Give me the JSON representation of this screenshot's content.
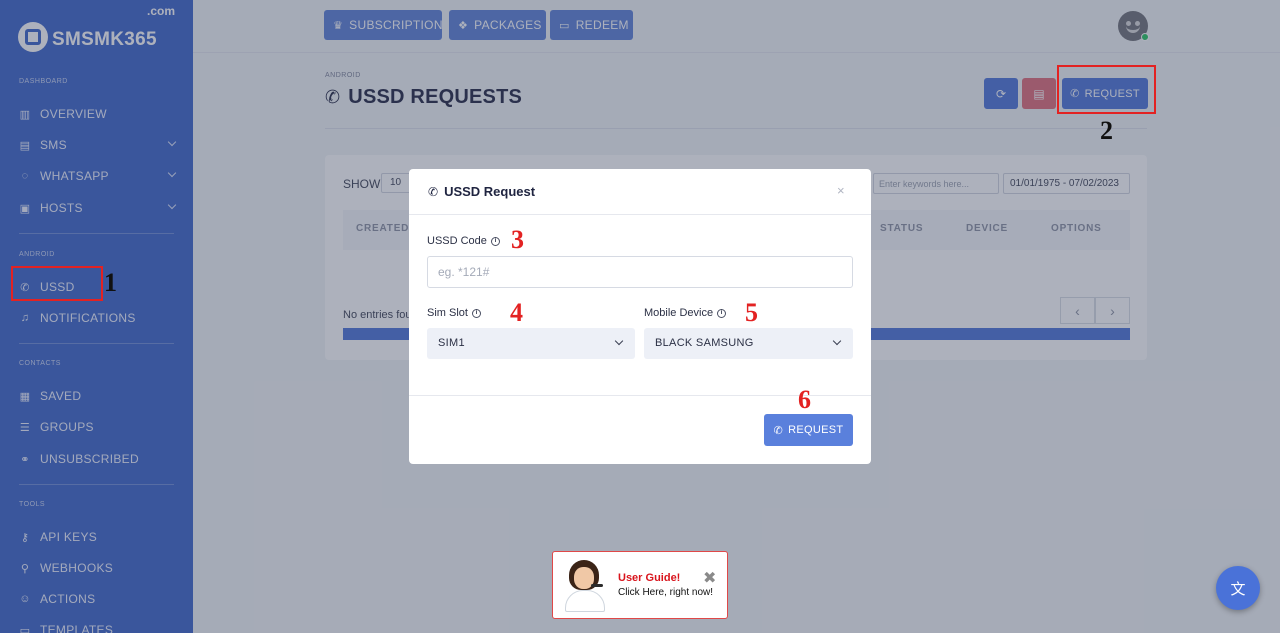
{
  "app": {
    "logo_text": "SMSMK365",
    "logo_suffix": ".com"
  },
  "sidebar": {
    "sections": [
      {
        "title": "DASHBOARD",
        "items": [
          {
            "label": "OVERVIEW",
            "icon": "bar-chart-icon",
            "has_submenu": false
          },
          {
            "label": "SMS",
            "icon": "message-icon",
            "has_submenu": true
          },
          {
            "label": "WHATSAPP",
            "icon": "whatsapp-icon",
            "has_submenu": true
          },
          {
            "label": "HOSTS",
            "icon": "server-icon",
            "has_submenu": true
          }
        ]
      },
      {
        "title": "ANDROID",
        "items": [
          {
            "label": "USSD",
            "icon": "ussd-icon",
            "has_submenu": false,
            "active": true
          },
          {
            "label": "NOTIFICATIONS",
            "icon": "bell-icon",
            "has_submenu": false
          }
        ]
      },
      {
        "title": "CONTACTS",
        "items": [
          {
            "label": "SAVED",
            "icon": "address-book-icon",
            "has_submenu": false
          },
          {
            "label": "GROUPS",
            "icon": "list-icon",
            "has_submenu": false
          },
          {
            "label": "UNSUBSCRIBED",
            "icon": "unlink-icon",
            "has_submenu": false
          }
        ]
      },
      {
        "title": "TOOLS",
        "items": [
          {
            "label": "API KEYS",
            "icon": "key-icon",
            "has_submenu": false
          },
          {
            "label": "WEBHOOKS",
            "icon": "webhook-icon",
            "has_submenu": false
          },
          {
            "label": "ACTIONS",
            "icon": "robot-icon",
            "has_submenu": false
          },
          {
            "label": "TEMPLATES",
            "icon": "template-icon",
            "has_submenu": false
          }
        ]
      }
    ]
  },
  "topbar": {
    "buttons": [
      {
        "label": "SUBSCRIPTION",
        "icon": "crown-icon"
      },
      {
        "label": "PACKAGES",
        "icon": "cubes-icon"
      },
      {
        "label": "REDEEM",
        "icon": "ticket-icon"
      }
    ]
  },
  "page": {
    "breadcrumb": "ANDROID",
    "title": "USSD REQUESTS",
    "request_label": "REQUEST"
  },
  "table": {
    "show_label": "SHOW",
    "show_value": "10",
    "search_placeholder": "Enter keywords here...",
    "date_range": "01/01/1975 - 07/02/2023",
    "columns": [
      "CREATED",
      "STATUS",
      "DEVICE",
      "OPTIONS"
    ],
    "empty_text": "No entries found",
    "pager_prev": "‹",
    "pager_next": "›"
  },
  "modal": {
    "title": "USSD Request",
    "close": "×",
    "ussd_label": "USSD Code",
    "ussd_placeholder": "eg. *121#",
    "sim_label": "Sim Slot",
    "sim_value": "SIM1",
    "device_label": "Mobile Device",
    "device_value": "BLACK SAMSUNG",
    "submit_label": "REQUEST"
  },
  "annotations": [
    "1",
    "2",
    "3",
    "4",
    "5",
    "6"
  ],
  "guide": {
    "title": "User Guide!",
    "subtitle": "Click Here, right now!",
    "close": "✖"
  },
  "colors": {
    "sidebar": "#3a63c8",
    "primary": "#4a72d8",
    "danger": "#e06a78",
    "annotation": "#e32222"
  }
}
